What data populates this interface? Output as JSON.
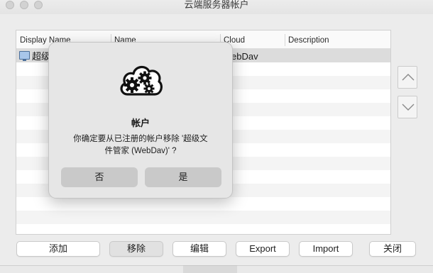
{
  "window": {
    "title": "云端服务器帐户"
  },
  "table": {
    "columns": [
      "Display Name",
      "Name",
      "Cloud",
      "Description"
    ],
    "rows": [
      {
        "display_name": "超级",
        "cloud": "WebDav",
        "description": ""
      }
    ]
  },
  "buttons": {
    "add": "添加",
    "remove": "移除",
    "edit": "编辑",
    "export": "Export",
    "import": "Import",
    "close": "关闭"
  },
  "dialog": {
    "title": "帐户",
    "message": "你确定要从已注册的帐户移除 '超级文件管家 (WebDav)' ?",
    "no": "否",
    "yes": "是",
    "icon": "cloud-gears-icon"
  },
  "icons": {
    "row_icon": "monitor-icon",
    "move_up": "chevron-up-icon",
    "move_down": "chevron-down-icon"
  }
}
